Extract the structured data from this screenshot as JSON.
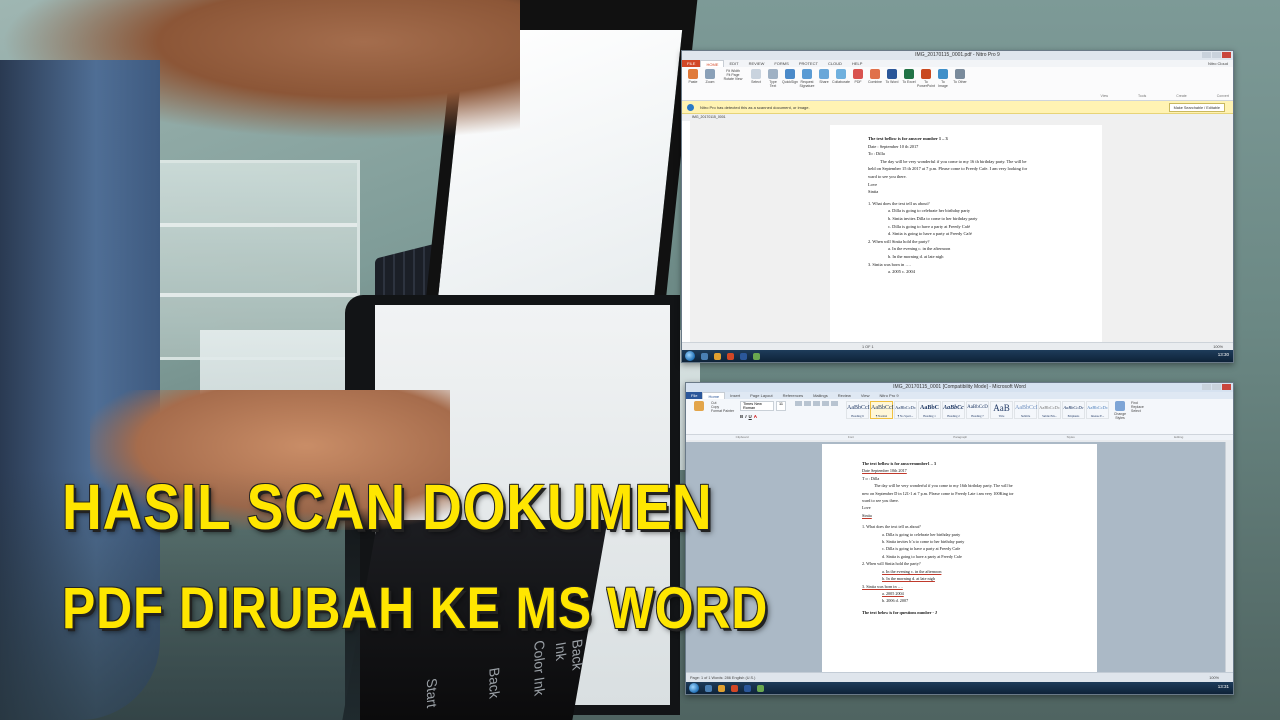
{
  "headline": {
    "line1": "HASIL SCAN DOKUMEN",
    "line2": "PDF DIRUBAH KE MS WORD"
  },
  "scanner_panel": {
    "labels": [
      "Back Ink",
      "Color Ink",
      "Back",
      "Start"
    ]
  },
  "pdf_window": {
    "title": "IMG_20170115_0001.pdf - Nitro Pro 9",
    "tabs": [
      "FILE",
      "HOME",
      "EDIT",
      "REVIEW",
      "FORMS",
      "PROTECT",
      "CLOUD",
      "HELP"
    ],
    "ribbon": [
      "Paste",
      "Zoom",
      "Fit Width",
      "Fit Page",
      "Rotate View",
      "Select",
      "Type Text",
      "QuickSign",
      "Request Signature",
      "Share",
      "Collaborate",
      "PDF",
      "Combine",
      "To Word",
      "To Excel",
      "To PowerPoint",
      "To Image",
      "To Other"
    ],
    "groups": [
      "View",
      "Tools",
      "Create",
      "Convert"
    ],
    "user": "Nitro Cloud",
    "notice": "Nitro Pro has detected this as a scanned document, or image.",
    "notice_button": "Make Searchable / Editable",
    "doc_tab": "IMG_20170115_0001",
    "page_indicator": "1 OF 1",
    "zoom": "100%",
    "page_lines": [
      "The text bellow is for answer number 1 – 3",
      "Date : September 10 th 2017",
      "To : Dilla",
      "The day will be very wonderful if you come to my 16 th birthday party. The will be",
      "held on September 15 th 2017 at 7 p.m. Please come to Freedy Cafe. I am very looking for",
      "ward to see you there.",
      "Love",
      "Sintia",
      "1.   What does the text tell us about?",
      "a.  Dilla is going to celebrate her birthday party",
      "b.  Sintia invites Dilla to come to her birthday party",
      "c.  Dilla is going to have a party at Freedy Café",
      "d.  Sintia is going to have a party at Freedy Café",
      "2.   When will Sintia hold the party?",
      "a.  In the evening                                   c.  in the afternoon",
      "b.  In the morning                                   d. at late nigh",
      "3.   Sintia was born in ….",
      "a.  2005                                              c.  2004"
    ],
    "clock": "13:30"
  },
  "word_window": {
    "title": "IMG_20170115_0001 [Compatibility Mode] - Microsoft Word",
    "tabs": [
      "File",
      "Home",
      "Insert",
      "Page Layout",
      "References",
      "Mailings",
      "Review",
      "View",
      "Nitro Pro 9"
    ],
    "clipboard": [
      "Cut",
      "Copy",
      "Format Painter"
    ],
    "font_name": "Times New Roman",
    "font_size": "11",
    "styles": [
      {
        "sample": "AaBbCcI",
        "name": "Heading 6"
      },
      {
        "sample": "AaBbCcI",
        "name": "¶ Normal"
      },
      {
        "sample": "AaBbCcDc",
        "name": "¶ No Spaci..."
      },
      {
        "sample": "AaBbC",
        "name": "Heading 1"
      },
      {
        "sample": "AaBbCc",
        "name": "Heading 2"
      },
      {
        "sample": "AaBbCcD",
        "name": "Heading 7"
      },
      {
        "sample": "AaB",
        "name": "Title"
      },
      {
        "sample": "AaBbCcI",
        "name": "Subtitle"
      },
      {
        "sample": "AaBbCcDc",
        "name": "Subtle Em..."
      },
      {
        "sample": "AaBbCcDc",
        "name": "Emphasis"
      },
      {
        "sample": "AaBbCcDc",
        "name": "Intense E..."
      }
    ],
    "editing": [
      "Find",
      "Replace",
      "Select"
    ],
    "change_styles": "Change Styles",
    "groups": [
      "Clipboard",
      "Font",
      "Paragraph",
      "Styles",
      "Editing"
    ],
    "status": "Page: 1 of 1   Words: 286   English (U.S.)",
    "zoom": "100%",
    "page_lines": [
      "The text bellow is for answernumber1 – 3",
      "Date  September 10th 2017",
      "T o : Dilla",
      "The day will be very wonderful if you come to my 16th birthday party. The will be",
      "new  on  September   D  in 12l>1  at  7 p.m. Please come to Freedy Late  i am very 100King tor",
      "ward to see you there.",
      "Love",
      "Sintia",
      "1.   What does the text tell us about?",
      "a.  Dilla is going to celebrate her birthday party",
      "b.  Sintia invites b’a  to come to her birthday party",
      "c.  Dilla is going to have a party at Freedy Cafe",
      "d.  Sintia is going to have a party at Freedy Cafe",
      "2.   When will Sintia hold the party?",
      "a.  In the evening                                   c.  in the afternoon",
      "b.  In the morning                                   d. at late nigh",
      "3.   Sintia was born in ….",
      "a.  2005                                               2004",
      "b.  2006                                           d.  2007",
      "The text below is for questions number  -  J"
    ],
    "clock": "13:31"
  },
  "colors": {
    "headline": "#ffe600",
    "nitro_accent": "#d24726",
    "notice_bar": "#fff3b3",
    "word_accent": "#2b579a"
  }
}
